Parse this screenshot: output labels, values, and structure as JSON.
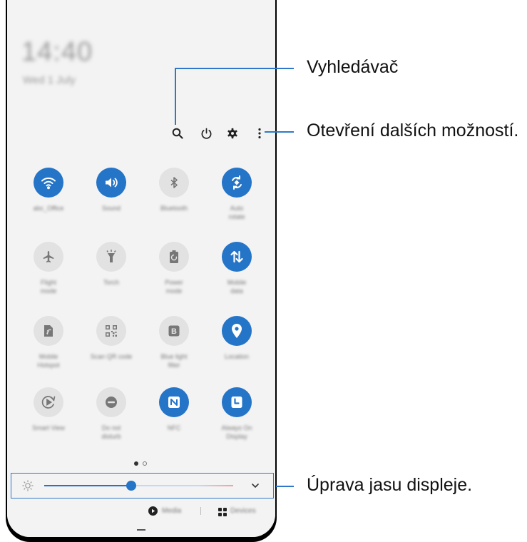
{
  "status": {
    "time": "14:40",
    "date": "Wed 1 July"
  },
  "toolbar": {
    "search_icon": "search-icon",
    "power_icon": "power-icon",
    "settings_icon": "gear-icon",
    "more_icon": "more-vertical-icon"
  },
  "tiles": [
    {
      "label": "abc_Office",
      "state": "on",
      "icon": "wifi-icon"
    },
    {
      "label": "Sound",
      "state": "on",
      "icon": "volume-icon"
    },
    {
      "label": "Bluetooth",
      "state": "off",
      "icon": "bluetooth-icon"
    },
    {
      "label": "Auto\nrotate",
      "state": "on",
      "icon": "auto-rotate-icon"
    },
    {
      "label": "Flight\nmode",
      "state": "off",
      "icon": "airplane-icon"
    },
    {
      "label": "Torch",
      "state": "off",
      "icon": "torch-icon"
    },
    {
      "label": "Power\nmode",
      "state": "off",
      "icon": "battery-icon"
    },
    {
      "label": "Mobile\ndata",
      "state": "on",
      "icon": "mobile-data-icon"
    },
    {
      "label": "Mobile\nHotspot",
      "state": "off",
      "icon": "hotspot-icon"
    },
    {
      "label": "Scan QR code",
      "state": "off",
      "icon": "qr-code-icon"
    },
    {
      "label": "Blue light\nfilter",
      "state": "off",
      "icon": "blue-light-icon"
    },
    {
      "label": "Location",
      "state": "on",
      "icon": "location-icon"
    },
    {
      "label": "Smart View",
      "state": "off",
      "icon": "smart-view-icon"
    },
    {
      "label": "Do not\ndisturb",
      "state": "off",
      "icon": "do-not-disturb-icon"
    },
    {
      "label": "NFC",
      "state": "on",
      "icon": "nfc-icon"
    },
    {
      "label": "Always On\nDisplay",
      "state": "on",
      "icon": "always-on-display-icon"
    }
  ],
  "pager": {
    "pages": 2,
    "current": 1
  },
  "brightness": {
    "level": 0.46,
    "icon": "sun-icon",
    "expand_icon": "chevron-down-icon"
  },
  "footer": {
    "media_label": "Media",
    "devices_label": "Devices"
  },
  "callouts": {
    "search": "Vyhledávač",
    "more_options": "Otevření dalších možností.",
    "brightness": "Úprava jasu displeje."
  },
  "colors": {
    "accent": "#2474c8",
    "tile_off": "#e2e2e2",
    "panel": "#f3f3f3",
    "callout_line": "#2f78c9",
    "slider_end": "#f2a0a0"
  }
}
